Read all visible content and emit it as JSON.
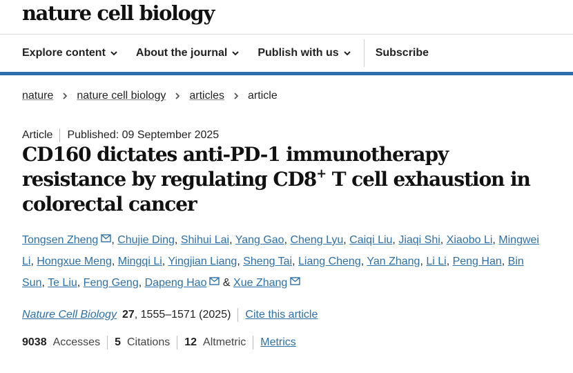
{
  "brand": "nature cell biology",
  "nav": {
    "explore": "Explore content",
    "about": "About the journal",
    "publish": "Publish with us",
    "subscribe": "Subscribe"
  },
  "breadcrumb": [
    "nature",
    "nature cell biology",
    "articles",
    "article"
  ],
  "meta": {
    "type": "Article",
    "published": "Published: 09 September 2025"
  },
  "title": {
    "part1": "CD160 dictates anti-PD-1 immunotherapy resistance by regulating CD8",
    "sup": "+",
    "part2": " T cell exhaustion in colorectal cancer"
  },
  "authors": [
    {
      "name": "Tongsen Zheng",
      "mail": true
    },
    {
      "name": "Chujie Ding"
    },
    {
      "name": "Shihui Lai"
    },
    {
      "name": "Yang Gao"
    },
    {
      "name": "Cheng Lyu"
    },
    {
      "name": "Caiqi Liu"
    },
    {
      "name": "Jiaqi Shi"
    },
    {
      "name": "Xiaobo Li"
    },
    {
      "name": "Mingwei Li"
    },
    {
      "name": "Hongxue Meng"
    },
    {
      "name": "Mingqi Li"
    },
    {
      "name": "Yingjian Liang"
    },
    {
      "name": "Sheng Tai"
    },
    {
      "name": "Liang Cheng"
    },
    {
      "name": "Yan Zhang"
    },
    {
      "name": "Li Li"
    },
    {
      "name": "Peng Han"
    },
    {
      "name": "Bin Sun"
    },
    {
      "name": "Te Liu"
    },
    {
      "name": "Feng Geng"
    },
    {
      "name": "Dapeng Hao",
      "mail": true
    },
    {
      "name": "Xue Zhang",
      "mail": true
    }
  ],
  "citation": {
    "journal": "Nature Cell Biology",
    "volume": "27",
    "pages": ", 1555–1571 (2025)",
    "cite": "Cite this article"
  },
  "metrics": {
    "accesses_value": "9038",
    "accesses_label": "Accesses",
    "citations_value": "5",
    "citations_label": "Citations",
    "altmetric_value": "12",
    "altmetric_label": "Altmetric",
    "link": "Metrics"
  },
  "colors": {
    "link": "#2d6fa8",
    "nav_rule": "#2d6fa8"
  },
  "icons": {
    "dropdown": "chevron-down-icon",
    "breadcrumb": "chevron-right-icon",
    "email": "mail-icon"
  }
}
